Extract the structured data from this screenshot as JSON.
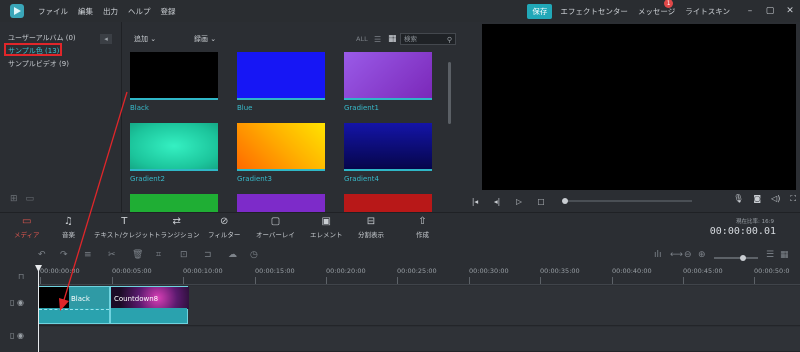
{
  "menu": [
    "ファイル",
    "編集",
    "出力",
    "ヘルプ",
    "登録"
  ],
  "title_right": {
    "save": "保存",
    "effects_center": "エフェクトセンター",
    "messages": "メッセージ",
    "message_badge": "1",
    "skin": "ライトスキン"
  },
  "library": [
    {
      "label": "ユーザーアルバム (0)"
    },
    {
      "label": "サンプル色 (13)"
    },
    {
      "label": "サンプルビデオ (9)"
    }
  ],
  "media_toolbar": {
    "import": "追加",
    "record": "録画",
    "all": "ALL",
    "search_placeholder": "検索"
  },
  "media_tiles": [
    {
      "label": "Black",
      "color": "#000000"
    },
    {
      "label": "Blue",
      "color": "#1616f5"
    },
    {
      "label": "Gradient1",
      "color": "#8a3fd6"
    },
    {
      "label": "Gradient2",
      "color": "#21d9a8"
    },
    {
      "label": "Gradient3",
      "color": "#ffb400"
    },
    {
      "label": "Gradient4",
      "color": "#0b0b7a"
    },
    {
      "label": "",
      "color": "#1fae34"
    },
    {
      "label": "",
      "color": "#7d2bc9"
    },
    {
      "label": "",
      "color": "#b81818"
    }
  ],
  "tabs": [
    {
      "label": "メディア",
      "icon": "folder-icon"
    },
    {
      "label": "音楽",
      "icon": "music-icon"
    },
    {
      "label": "テキスト/クレジット",
      "icon": "text-icon"
    },
    {
      "label": "トランジション",
      "icon": "transition-icon"
    },
    {
      "label": "フィルター",
      "icon": "filter-icon"
    },
    {
      "label": "オーバーレイ",
      "icon": "overlay-icon"
    },
    {
      "label": "エレメント",
      "icon": "element-icon"
    },
    {
      "label": "分割表示",
      "icon": "split-icon"
    },
    {
      "label": "作成",
      "icon": "export-icon"
    }
  ],
  "preview": {
    "ratio_label": "現在比率: 16:9",
    "timecode": "00:00:00.01"
  },
  "ruler": [
    "00:00:00:00",
    "00:00:05:00",
    "00:00:10:00",
    "00:00:15:00",
    "00:00:20:00",
    "00:00:25:00",
    "00:00:30:00",
    "00:00:35:00",
    "00:00:40:00",
    "00:00:45:00",
    "00:00:50:0"
  ],
  "clips": [
    {
      "title": "Black"
    },
    {
      "title": "Countdown8"
    }
  ],
  "colors": {
    "accent": "#21a8b8",
    "highlight_box": "#e0262a",
    "active_tab": "#e0574f"
  }
}
